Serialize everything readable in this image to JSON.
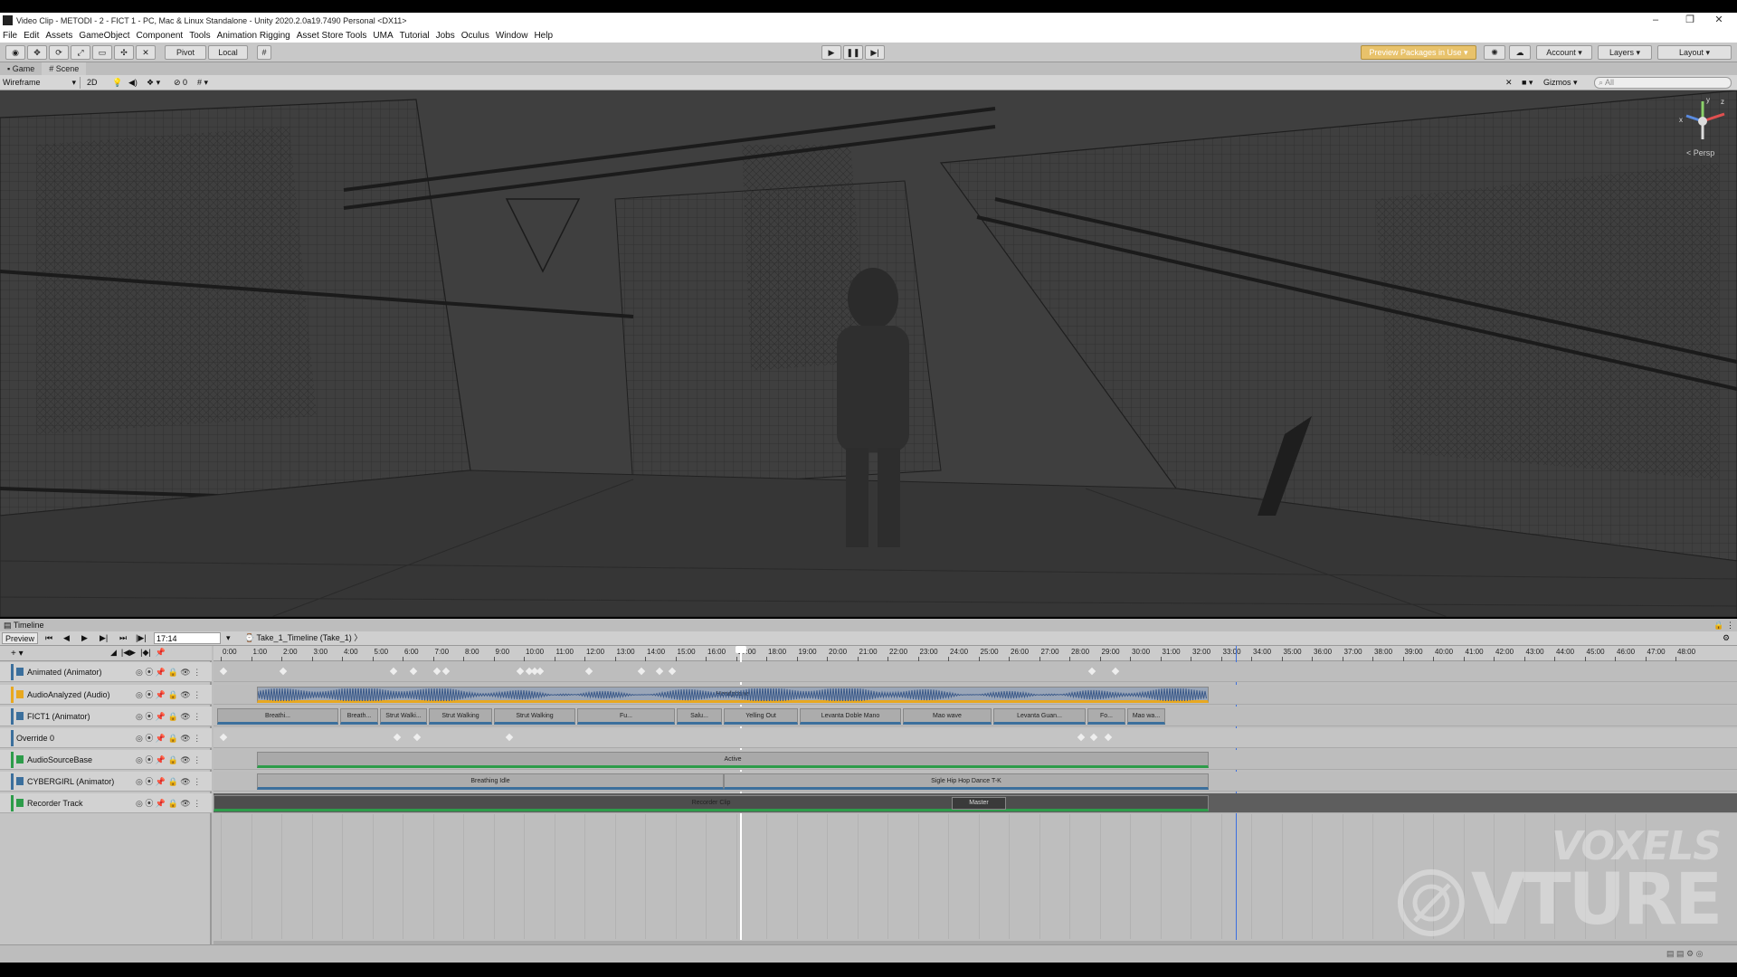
{
  "window": {
    "title": "Video Clip - METODI - 2 - FICT 1 - PC, Mac & Linux Standalone - Unity 2020.2.0a19.7490 Personal <DX11>",
    "minimize": "–",
    "maximize": "❐",
    "close": "✕"
  },
  "menu": [
    "File",
    "Edit",
    "Assets",
    "GameObject",
    "Component",
    "Tools",
    "Animation Rigging",
    "Asset Store Tools",
    "UMA",
    "Tutorial",
    "Jobs",
    "Oculus",
    "Window",
    "Help"
  ],
  "toolbar": {
    "pivot": "Pivot",
    "local": "Local",
    "play": "▶",
    "pause": "❚❚",
    "step": "▶|",
    "preview_packages": "Preview Packages in Use ▾",
    "account": "Account",
    "layers": "Layers",
    "layout": "Layout"
  },
  "view_tabs": [
    {
      "label": "Game"
    },
    {
      "label": "Scene"
    }
  ],
  "scene_toolbar": {
    "shading_mode": "Wireframe",
    "mode_2d": "2D",
    "gizmos": "Gizmos",
    "search_placeholder": "All"
  },
  "scene": {
    "axis_x": "x",
    "axis_y": "y",
    "axis_z": "z",
    "projection": "< Persp"
  },
  "timeline": {
    "title": "Timeline",
    "preview": "Preview",
    "current_time": "17:14",
    "asset": "Take_1_Timeline (Take_1)",
    "ruler_ticks": [
      "0:00",
      "1:00",
      "2:00",
      "3:00",
      "4:00",
      "5:00",
      "6:00",
      "7:00",
      "8:00",
      "9:00",
      "10:00",
      "11:00",
      "12:00",
      "13:00",
      "14:00",
      "15:00",
      "16:00",
      "17:00",
      "18:00",
      "19:00",
      "20:00",
      "21:00",
      "22:00",
      "23:00",
      "24:00",
      "25:00",
      "26:00",
      "27:00",
      "28:00",
      "29:00",
      "30:00",
      "31:00",
      "32:00",
      "33:00",
      "34:00",
      "35:00",
      "36:00",
      "37:00",
      "38:00",
      "39:00",
      "40:00",
      "41:00",
      "42:00",
      "43:00",
      "44:00",
      "45:00",
      "46:00",
      "47:00",
      "48:00"
    ],
    "tracks": [
      {
        "label": "Animated (Animator)",
        "color": "#3b6f9c"
      },
      {
        "label": "AudioAnalyzed (Audio)",
        "color": "#e8a820"
      },
      {
        "label": "FICT1 (Animator)",
        "color": "#3b6f9c"
      },
      {
        "label": "Override 0",
        "color": "#3b6f9c"
      },
      {
        "label": "AudioSourceBase",
        "color": "#2d9c4a"
      },
      {
        "label": "CYBERGIRL (Animator)",
        "color": "#3b6f9c"
      },
      {
        "label": "Recorder Track",
        "color": "#2d9c4a"
      }
    ],
    "audio_clip": "Headphone",
    "fict_clips": [
      "Breathi...",
      "Breath...",
      "Strut Walki...",
      "Strut Walking",
      "Strut Walking",
      "Fu...",
      "Salu...",
      "Yelling Out",
      "Levanta Doble Mano",
      "Mao wave",
      "Levanta Guan...",
      "Fo...",
      "Mao wa..."
    ],
    "active_clip": "Active",
    "cybergirl_clips": [
      "Breathing Idle",
      "Sigle Hip Hop Dance T-K"
    ],
    "recorder_clips": [
      "Recorder Clip",
      "Master"
    ]
  },
  "watermark": {
    "top": "VOXELS",
    "bottom": "VTURE"
  }
}
